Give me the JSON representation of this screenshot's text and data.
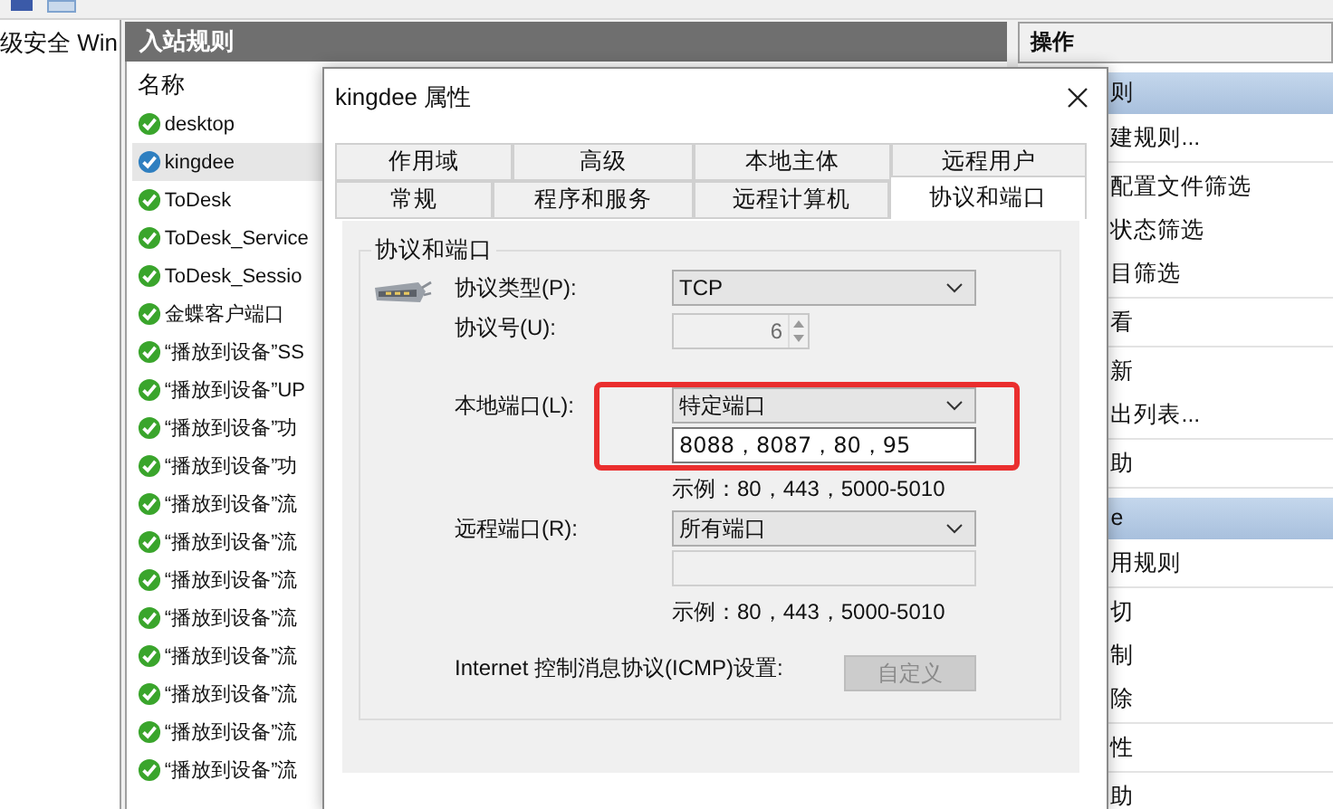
{
  "nav_pane": {
    "title": "级安全 Win"
  },
  "rules_pane": {
    "title": "入站规则",
    "column": "名称",
    "rows": [
      {
        "name": "desktop",
        "selected": false
      },
      {
        "name": "kingdee",
        "selected": true
      },
      {
        "name": "ToDesk",
        "selected": false
      },
      {
        "name": "ToDesk_Service",
        "selected": false
      },
      {
        "name": "ToDesk_Sessio",
        "selected": false
      },
      {
        "name": "金蝶客户端口",
        "selected": false
      },
      {
        "name": "“播放到设备”SS",
        "selected": false
      },
      {
        "name": "“播放到设备”UP",
        "selected": false
      },
      {
        "name": "“播放到设备”功",
        "selected": false
      },
      {
        "name": "“播放到设备”功",
        "selected": false
      },
      {
        "name": "“播放到设备”流",
        "selected": false
      },
      {
        "name": "“播放到设备”流",
        "selected": false
      },
      {
        "name": "“播放到设备”流",
        "selected": false
      },
      {
        "name": "“播放到设备”流",
        "selected": false
      },
      {
        "name": "“播放到设备”流",
        "selected": false
      },
      {
        "name": "“播放到设备”流",
        "selected": false
      },
      {
        "name": "“播放到设备”流",
        "selected": false
      },
      {
        "name": "“播放到设备”流",
        "selected": false
      }
    ]
  },
  "actions_pane": {
    "title": "操作",
    "sections": [
      {
        "header": "则",
        "groups": [
          [
            "建规则..."
          ],
          [
            "配置文件筛选",
            "状态筛选",
            "目筛选"
          ],
          [
            "看"
          ],
          [
            "新",
            "出列表..."
          ],
          [
            "助"
          ]
        ]
      },
      {
        "header": "e",
        "groups": [
          [
            "用规则"
          ],
          [
            "切",
            "制",
            "除"
          ],
          [
            "性"
          ],
          [
            "助"
          ]
        ]
      }
    ]
  },
  "dialog": {
    "title": "kingdee 属性",
    "tab_rows": [
      [
        {
          "label": "作用域",
          "selected": false
        },
        {
          "label": "高级",
          "selected": false
        },
        {
          "label": "本地主体",
          "selected": false
        },
        {
          "label": "远程用户",
          "selected": false
        }
      ],
      [
        {
          "label": "常规",
          "selected": false
        },
        {
          "label": "程序和服务",
          "selected": false
        },
        {
          "label": "远程计算机",
          "selected": false
        },
        {
          "label": "协议和端口",
          "selected": true
        }
      ]
    ],
    "group_title": "协议和端口",
    "protocol_type": {
      "label": "协议类型(P):",
      "value": "TCP"
    },
    "protocol_number": {
      "label": "协议号(U):",
      "value": "6",
      "disabled": true
    },
    "local_port": {
      "label": "本地端口(L):",
      "value": "特定端口",
      "ports": "8088，8087，80，95",
      "ports_disabled": false,
      "example": "示例：80，443，5000-5010",
      "highlighted": true
    },
    "remote_port": {
      "label": "远程端口(R):",
      "value": "所有端口",
      "ports_disabled": true,
      "example": "示例：80，443，5000-5010"
    },
    "icmp": {
      "label": "Internet 控制消息协议(ICMP)设置:",
      "button": "自定义",
      "button_disabled": true
    }
  }
}
